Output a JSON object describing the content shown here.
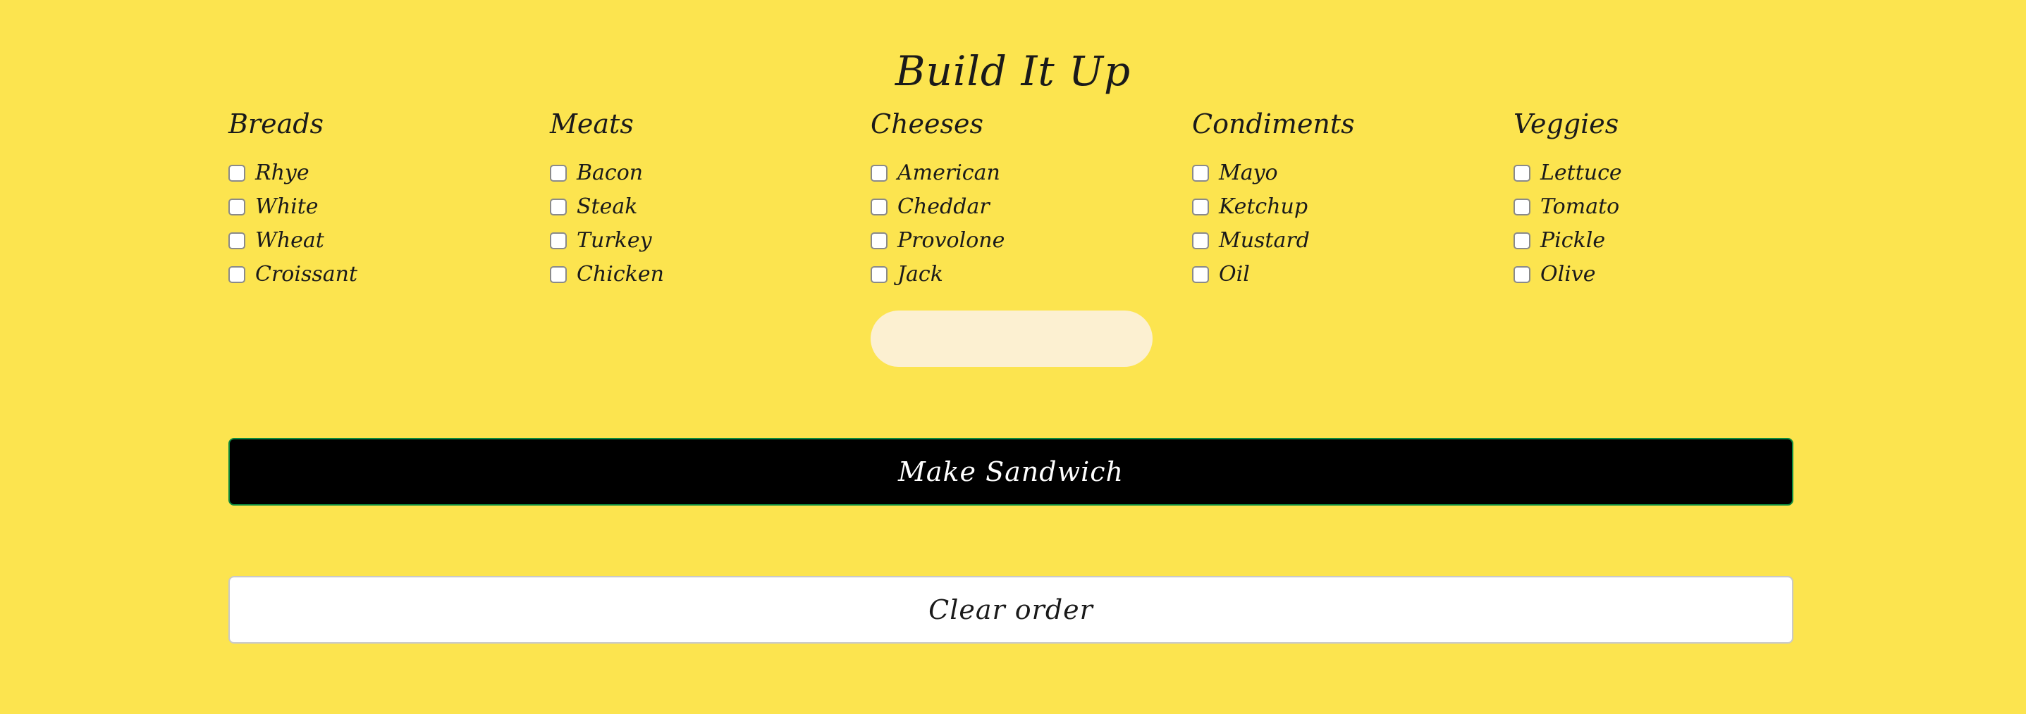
{
  "page": {
    "title": "Build It Up",
    "background_color": "#fce44f"
  },
  "columns": [
    {
      "heading": "Breads",
      "options": [
        "Rhye",
        "White",
        "Wheat",
        "Croissant"
      ]
    },
    {
      "heading": "Meats",
      "options": [
        "Bacon",
        "Steak",
        "Turkey",
        "Chicken"
      ]
    },
    {
      "heading": "Cheeses",
      "options": [
        "American",
        "Cheddar",
        "Provolone",
        "Jack"
      ]
    },
    {
      "heading": "Condiments",
      "options": [
        "Mayo",
        "Ketchup",
        "Mustard",
        "Oil"
      ]
    },
    {
      "heading": "Veggies",
      "options": [
        "Lettuce",
        "Tomato",
        "Pickle",
        "Olive"
      ]
    }
  ],
  "actions": {
    "make_label": "Make Sandwich",
    "clear_label": "Clear order"
  },
  "colors": {
    "make_button_bg": "#000000",
    "make_button_border": "#0e8a3e",
    "clear_button_bg": "#ffffff",
    "output_pill_bg": "#fcf0d1"
  }
}
